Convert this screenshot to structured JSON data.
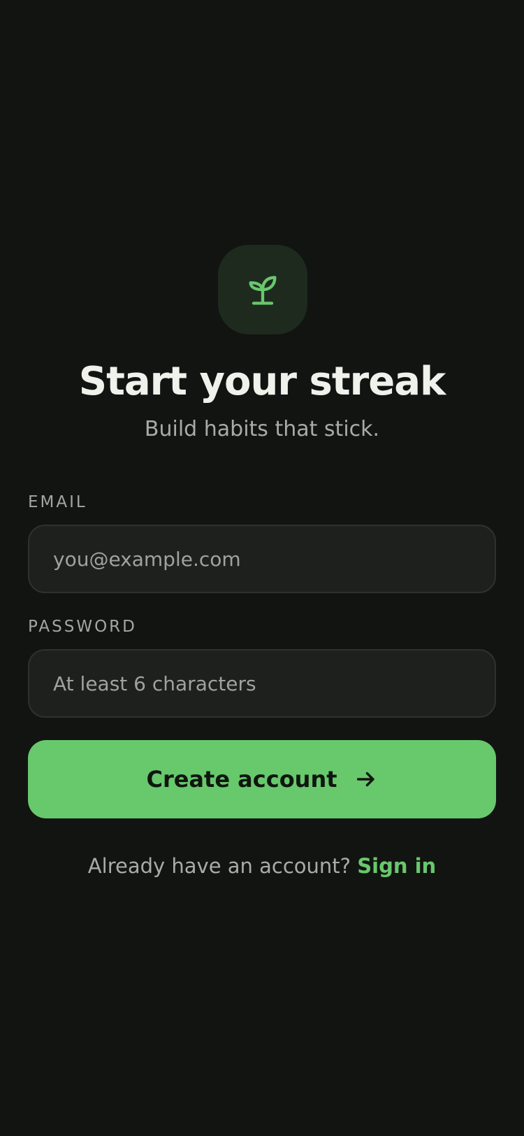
{
  "header": {
    "logo_icon": "sprout-icon",
    "title": "Start your streak",
    "subtitle": "Build habits that stick."
  },
  "form": {
    "email": {
      "label": "EMAIL",
      "value": "",
      "placeholder": "you@example.com"
    },
    "password": {
      "label": "PASSWORD",
      "value": "",
      "placeholder": "At least 6 characters"
    },
    "submit": {
      "label": "Create account",
      "icon": "arrow-right-icon"
    }
  },
  "footer": {
    "prompt": "Already have an account?",
    "link_label": "Sign in"
  },
  "colors": {
    "background": "#121412",
    "accent": "#68c86c",
    "logo_tile": "#1f2a1f",
    "input_bg": "#1e201e"
  }
}
